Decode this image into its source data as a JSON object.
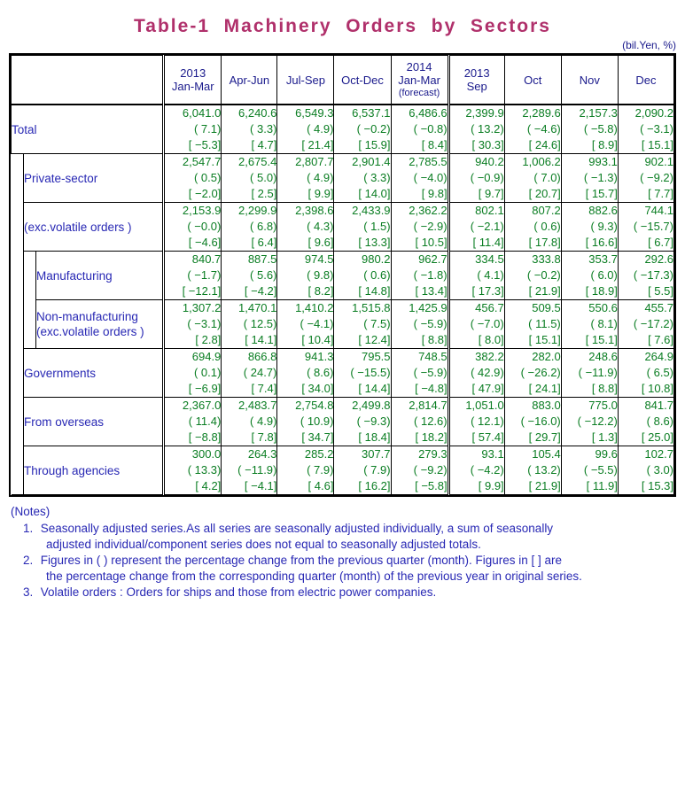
{
  "title": "Table-1  Machinery  Orders  by  Sectors",
  "unit": "(bil.Yen, %)",
  "header": {
    "corner": "",
    "columns": [
      {
        "year": "2013",
        "period": "Jan-Mar",
        "note": ""
      },
      {
        "year": "",
        "period": "Apr-Jun",
        "note": ""
      },
      {
        "year": "",
        "period": "Jul-Sep",
        "note": ""
      },
      {
        "year": "",
        "period": "Oct-Dec",
        "note": ""
      },
      {
        "year": "2014",
        "period": "Jan-Mar",
        "note": "(forecast)"
      },
      {
        "year": "2013",
        "period": "Sep",
        "note": ""
      },
      {
        "year": "",
        "period": "Oct",
        "note": ""
      },
      {
        "year": "",
        "period": "Nov",
        "note": ""
      },
      {
        "year": "",
        "period": "Dec",
        "note": ""
      }
    ]
  },
  "rows": [
    {
      "label": "Total",
      "indent": 0,
      "values": [
        {
          "level": "6,041.0",
          "qoq": "( 7.1)",
          "yoy": "[ −5.3]"
        },
        {
          "level": "6,240.6",
          "qoq": "( 3.3)",
          "yoy": "[ 4.7]"
        },
        {
          "level": "6,549.3",
          "qoq": "( 4.9)",
          "yoy": "[ 21.4]"
        },
        {
          "level": "6,537.1",
          "qoq": "( −0.2)",
          "yoy": "[ 15.9]"
        },
        {
          "level": "6,486.6",
          "qoq": "( −0.8)",
          "yoy": "[ 8.4]"
        },
        {
          "level": "2,399.9",
          "qoq": "( 13.2)",
          "yoy": "[ 30.3]"
        },
        {
          "level": "2,289.6",
          "qoq": "( −4.6)",
          "yoy": "[ 24.6]"
        },
        {
          "level": "2,157.3",
          "qoq": "( −5.8)",
          "yoy": "[ 8.9]"
        },
        {
          "level": "2,090.2",
          "qoq": "( −3.1)",
          "yoy": "[ 15.1]"
        }
      ]
    },
    {
      "label": "Private-sector",
      "indent": 1,
      "values": [
        {
          "level": "2,547.7",
          "qoq": "( 0.5)",
          "yoy": "[ −2.0]"
        },
        {
          "level": "2,675.4",
          "qoq": "( 5.0)",
          "yoy": "[ 2.5]"
        },
        {
          "level": "2,807.7",
          "qoq": "( 4.9)",
          "yoy": "[ 9.9]"
        },
        {
          "level": "2,901.4",
          "qoq": "( 3.3)",
          "yoy": "[ 14.0]"
        },
        {
          "level": "2,785.5",
          "qoq": "( −4.0)",
          "yoy": "[ 9.8]"
        },
        {
          "level": "940.2",
          "qoq": "( −0.9)",
          "yoy": "[ 9.7]"
        },
        {
          "level": "1,006.2",
          "qoq": "( 7.0)",
          "yoy": "[ 20.7]"
        },
        {
          "level": "993.1",
          "qoq": "( −1.3)",
          "yoy": "[ 15.7]"
        },
        {
          "level": "902.1",
          "qoq": "( −9.2)",
          "yoy": "[ 7.7]"
        }
      ]
    },
    {
      "label": "(exc.volatile orders )",
      "indent": 1,
      "values": [
        {
          "level": "2,153.9",
          "qoq": "( −0.0)",
          "yoy": "[ −4.6]"
        },
        {
          "level": "2,299.9",
          "qoq": "( 6.8)",
          "yoy": "[ 6.4]"
        },
        {
          "level": "2,398.6",
          "qoq": "( 4.3)",
          "yoy": "[ 9.6]"
        },
        {
          "level": "2,433.9",
          "qoq": "( 1.5)",
          "yoy": "[ 13.3]"
        },
        {
          "level": "2,362.2",
          "qoq": "( −2.9)",
          "yoy": "[ 10.5]"
        },
        {
          "level": "802.1",
          "qoq": "( −2.1)",
          "yoy": "[ 11.4]"
        },
        {
          "level": "807.2",
          "qoq": "( 0.6)",
          "yoy": "[ 17.8]"
        },
        {
          "level": "882.6",
          "qoq": "( 9.3)",
          "yoy": "[ 16.6]"
        },
        {
          "level": "744.1",
          "qoq": "( −15.7)",
          "yoy": "[ 6.7]"
        }
      ]
    },
    {
      "label": "Manufacturing",
      "indent": 2,
      "values": [
        {
          "level": "840.7",
          "qoq": "( −1.7)",
          "yoy": "[ −12.1]"
        },
        {
          "level": "887.5",
          "qoq": "( 5.6)",
          "yoy": "[ −4.2]"
        },
        {
          "level": "974.5",
          "qoq": "( 9.8)",
          "yoy": "[ 8.2]"
        },
        {
          "level": "980.2",
          "qoq": "( 0.6)",
          "yoy": "[ 14.8]"
        },
        {
          "level": "962.7",
          "qoq": "( −1.8)",
          "yoy": "[ 13.4]"
        },
        {
          "level": "334.5",
          "qoq": "( 4.1)",
          "yoy": "[ 17.3]"
        },
        {
          "level": "333.8",
          "qoq": "( −0.2)",
          "yoy": "[ 21.9]"
        },
        {
          "level": "353.7",
          "qoq": "( 6.0)",
          "yoy": "[ 18.9]"
        },
        {
          "level": "292.6",
          "qoq": "( −17.3)",
          "yoy": "[ 5.5]"
        }
      ]
    },
    {
      "label": "Non-manufacturing\n(exc.volatile orders )",
      "indent": 2,
      "values": [
        {
          "level": "1,307.2",
          "qoq": "( −3.1)",
          "yoy": "[ 2.8]"
        },
        {
          "level": "1,470.1",
          "qoq": "( 12.5)",
          "yoy": "[ 14.1]"
        },
        {
          "level": "1,410.2",
          "qoq": "( −4.1)",
          "yoy": "[ 10.4]"
        },
        {
          "level": "1,515.8",
          "qoq": "( 7.5)",
          "yoy": "[ 12.4]"
        },
        {
          "level": "1,425.9",
          "qoq": "( −5.9)",
          "yoy": "[ 8.8]"
        },
        {
          "level": "456.7",
          "qoq": "( −7.0)",
          "yoy": "[ 8.0]"
        },
        {
          "level": "509.5",
          "qoq": "( 11.5)",
          "yoy": "[ 15.1]"
        },
        {
          "level": "550.6",
          "qoq": "( 8.1)",
          "yoy": "[ 15.1]"
        },
        {
          "level": "455.7",
          "qoq": "( −17.2)",
          "yoy": "[ 7.6]"
        }
      ]
    },
    {
      "label": "Governments",
      "indent": 1,
      "values": [
        {
          "level": "694.9",
          "qoq": "( 0.1)",
          "yoy": "[ −6.9]"
        },
        {
          "level": "866.8",
          "qoq": "( 24.7)",
          "yoy": "[ 7.4]"
        },
        {
          "level": "941.3",
          "qoq": "( 8.6)",
          "yoy": "[ 34.0]"
        },
        {
          "level": "795.5",
          "qoq": "( −15.5)",
          "yoy": "[ 14.4]"
        },
        {
          "level": "748.5",
          "qoq": "( −5.9)",
          "yoy": "[ −4.8]"
        },
        {
          "level": "382.2",
          "qoq": "( 42.9)",
          "yoy": "[ 47.9]"
        },
        {
          "level": "282.0",
          "qoq": "( −26.2)",
          "yoy": "[ 24.1]"
        },
        {
          "level": "248.6",
          "qoq": "( −11.9)",
          "yoy": "[ 8.8]"
        },
        {
          "level": "264.9",
          "qoq": "( 6.5)",
          "yoy": "[ 10.8]"
        }
      ]
    },
    {
      "label": "From overseas",
      "indent": 1,
      "values": [
        {
          "level": "2,367.0",
          "qoq": "( 11.4)",
          "yoy": "[ −8.8]"
        },
        {
          "level": "2,483.7",
          "qoq": "( 4.9)",
          "yoy": "[ 7.8]"
        },
        {
          "level": "2,754.8",
          "qoq": "( 10.9)",
          "yoy": "[ 34.7]"
        },
        {
          "level": "2,499.8",
          "qoq": "( −9.3)",
          "yoy": "[ 18.4]"
        },
        {
          "level": "2,814.7",
          "qoq": "( 12.6)",
          "yoy": "[ 18.2]"
        },
        {
          "level": "1,051.0",
          "qoq": "( 12.1)",
          "yoy": "[ 57.4]"
        },
        {
          "level": "883.0",
          "qoq": "( −16.0)",
          "yoy": "[ 29.7]"
        },
        {
          "level": "775.0",
          "qoq": "( −12.2)",
          "yoy": "[ 1.3]"
        },
        {
          "level": "841.7",
          "qoq": "( 8.6)",
          "yoy": "[ 25.0]"
        }
      ]
    },
    {
      "label": "Through agencies",
      "indent": 1,
      "values": [
        {
          "level": "300.0",
          "qoq": "( 13.3)",
          "yoy": "[ 4.2]"
        },
        {
          "level": "264.3",
          "qoq": "( −11.9)",
          "yoy": "[ −4.1]"
        },
        {
          "level": "285.2",
          "qoq": "( 7.9)",
          "yoy": "[ 4.6]"
        },
        {
          "level": "307.7",
          "qoq": "( 7.9)",
          "yoy": "[ 16.2]"
        },
        {
          "level": "279.3",
          "qoq": "( −9.2)",
          "yoy": "[ −5.8]"
        },
        {
          "level": "93.1",
          "qoq": "( −4.2)",
          "yoy": "[ 9.9]"
        },
        {
          "level": "105.4",
          "qoq": "( 13.2)",
          "yoy": "[ 21.9]"
        },
        {
          "level": "99.6",
          "qoq": "( −5.5)",
          "yoy": "[ 11.9]"
        },
        {
          "level": "102.7",
          "qoq": "( 3.0)",
          "yoy": "[ 15.3]"
        }
      ]
    }
  ],
  "notes": {
    "heading": "(Notes)",
    "items": [
      {
        "num": "1.",
        "line1": "Seasonally adjusted series.As all series are seasonally adjusted individually, a sum of seasonally",
        "line2": "adjusted individual/component series does not equal to seasonally adjusted totals."
      },
      {
        "num": "2.",
        "line1": "Figures in ( ) represent the percentage change from the previous quarter (month). Figures in [ ] are",
        "line2": "the percentage change from the corresponding quarter (month) of the previous year in original series."
      },
      {
        "num": "3.",
        "line1": "Volatile orders : Orders for ships and those from electric power companies.",
        "line2": ""
      }
    ]
  },
  "colors": {
    "title": "#b0306b",
    "label": "#2828b4",
    "number": "#0a7d22",
    "border": "#000000"
  },
  "chart_data": {
    "type": "table",
    "title": "Table-1  Machinery  Orders  by  Sectors",
    "unit": "bil.Yen, %",
    "columns": [
      "2013 Jan-Mar",
      "2013 Apr-Jun",
      "2013 Jul-Sep",
      "2013 Oct-Dec",
      "2014 Jan-Mar (forecast)",
      "2013 Sep",
      "2013 Oct",
      "2013 Nov",
      "2013 Dec"
    ],
    "rows": [
      {
        "name": "Total",
        "level": [
          6041.0,
          6240.6,
          6549.3,
          6537.1,
          6486.6,
          2399.9,
          2289.6,
          2157.3,
          2090.2
        ],
        "qoq_pct": [
          7.1,
          3.3,
          4.9,
          -0.2,
          -0.8,
          13.2,
          -4.6,
          -5.8,
          -3.1
        ],
        "yoy_pct": [
          -5.3,
          4.7,
          21.4,
          15.9,
          8.4,
          30.3,
          24.6,
          8.9,
          15.1
        ]
      },
      {
        "name": "Private-sector",
        "level": [
          2547.7,
          2675.4,
          2807.7,
          2901.4,
          2785.5,
          940.2,
          1006.2,
          993.1,
          902.1
        ],
        "qoq_pct": [
          0.5,
          5.0,
          4.9,
          3.3,
          -4.0,
          -0.9,
          7.0,
          -1.3,
          -9.2
        ],
        "yoy_pct": [
          -2.0,
          2.5,
          9.9,
          14.0,
          9.8,
          9.7,
          20.7,
          15.7,
          7.7
        ]
      },
      {
        "name": "Private-sector (exc.volatile orders)",
        "level": [
          2153.9,
          2299.9,
          2398.6,
          2433.9,
          2362.2,
          802.1,
          807.2,
          882.6,
          744.1
        ],
        "qoq_pct": [
          -0.0,
          6.8,
          4.3,
          1.5,
          -2.9,
          -2.1,
          0.6,
          9.3,
          -15.7
        ],
        "yoy_pct": [
          -4.6,
          6.4,
          9.6,
          13.3,
          10.5,
          11.4,
          17.8,
          16.6,
          6.7
        ]
      },
      {
        "name": "Manufacturing",
        "level": [
          840.7,
          887.5,
          974.5,
          980.2,
          962.7,
          334.5,
          333.8,
          353.7,
          292.6
        ],
        "qoq_pct": [
          -1.7,
          5.6,
          9.8,
          0.6,
          -1.8,
          4.1,
          -0.2,
          6.0,
          -17.3
        ],
        "yoy_pct": [
          -12.1,
          -4.2,
          8.2,
          14.8,
          13.4,
          17.3,
          21.9,
          18.9,
          5.5
        ]
      },
      {
        "name": "Non-manufacturing (exc.volatile orders)",
        "level": [
          1307.2,
          1470.1,
          1410.2,
          1515.8,
          1425.9,
          456.7,
          509.5,
          550.6,
          455.7
        ],
        "qoq_pct": [
          -3.1,
          12.5,
          -4.1,
          7.5,
          -5.9,
          -7.0,
          11.5,
          8.1,
          -17.2
        ],
        "yoy_pct": [
          2.8,
          14.1,
          10.4,
          12.4,
          8.8,
          8.0,
          15.1,
          15.1,
          7.6
        ]
      },
      {
        "name": "Governments",
        "level": [
          694.9,
          866.8,
          941.3,
          795.5,
          748.5,
          382.2,
          282.0,
          248.6,
          264.9
        ],
        "qoq_pct": [
          0.1,
          24.7,
          8.6,
          -15.5,
          -5.9,
          42.9,
          -26.2,
          -11.9,
          6.5
        ],
        "yoy_pct": [
          -6.9,
          7.4,
          34.0,
          14.4,
          -4.8,
          47.9,
          24.1,
          8.8,
          10.8
        ]
      },
      {
        "name": "From overseas",
        "level": [
          2367.0,
          2483.7,
          2754.8,
          2499.8,
          2814.7,
          1051.0,
          883.0,
          775.0,
          841.7
        ],
        "qoq_pct": [
          11.4,
          4.9,
          10.9,
          -9.3,
          12.6,
          12.1,
          -16.0,
          -12.2,
          8.6
        ],
        "yoy_pct": [
          -8.8,
          7.8,
          34.7,
          18.4,
          18.2,
          57.4,
          29.7,
          1.3,
          25.0
        ]
      },
      {
        "name": "Through agencies",
        "level": [
          300.0,
          264.3,
          285.2,
          307.7,
          279.3,
          93.1,
          105.4,
          99.6,
          102.7
        ],
        "qoq_pct": [
          13.3,
          -11.9,
          7.9,
          7.9,
          -9.2,
          -4.2,
          13.2,
          -5.5,
          3.0
        ],
        "yoy_pct": [
          4.2,
          -4.1,
          4.6,
          16.2,
          -5.8,
          9.9,
          21.9,
          11.9,
          15.3
        ]
      }
    ]
  }
}
